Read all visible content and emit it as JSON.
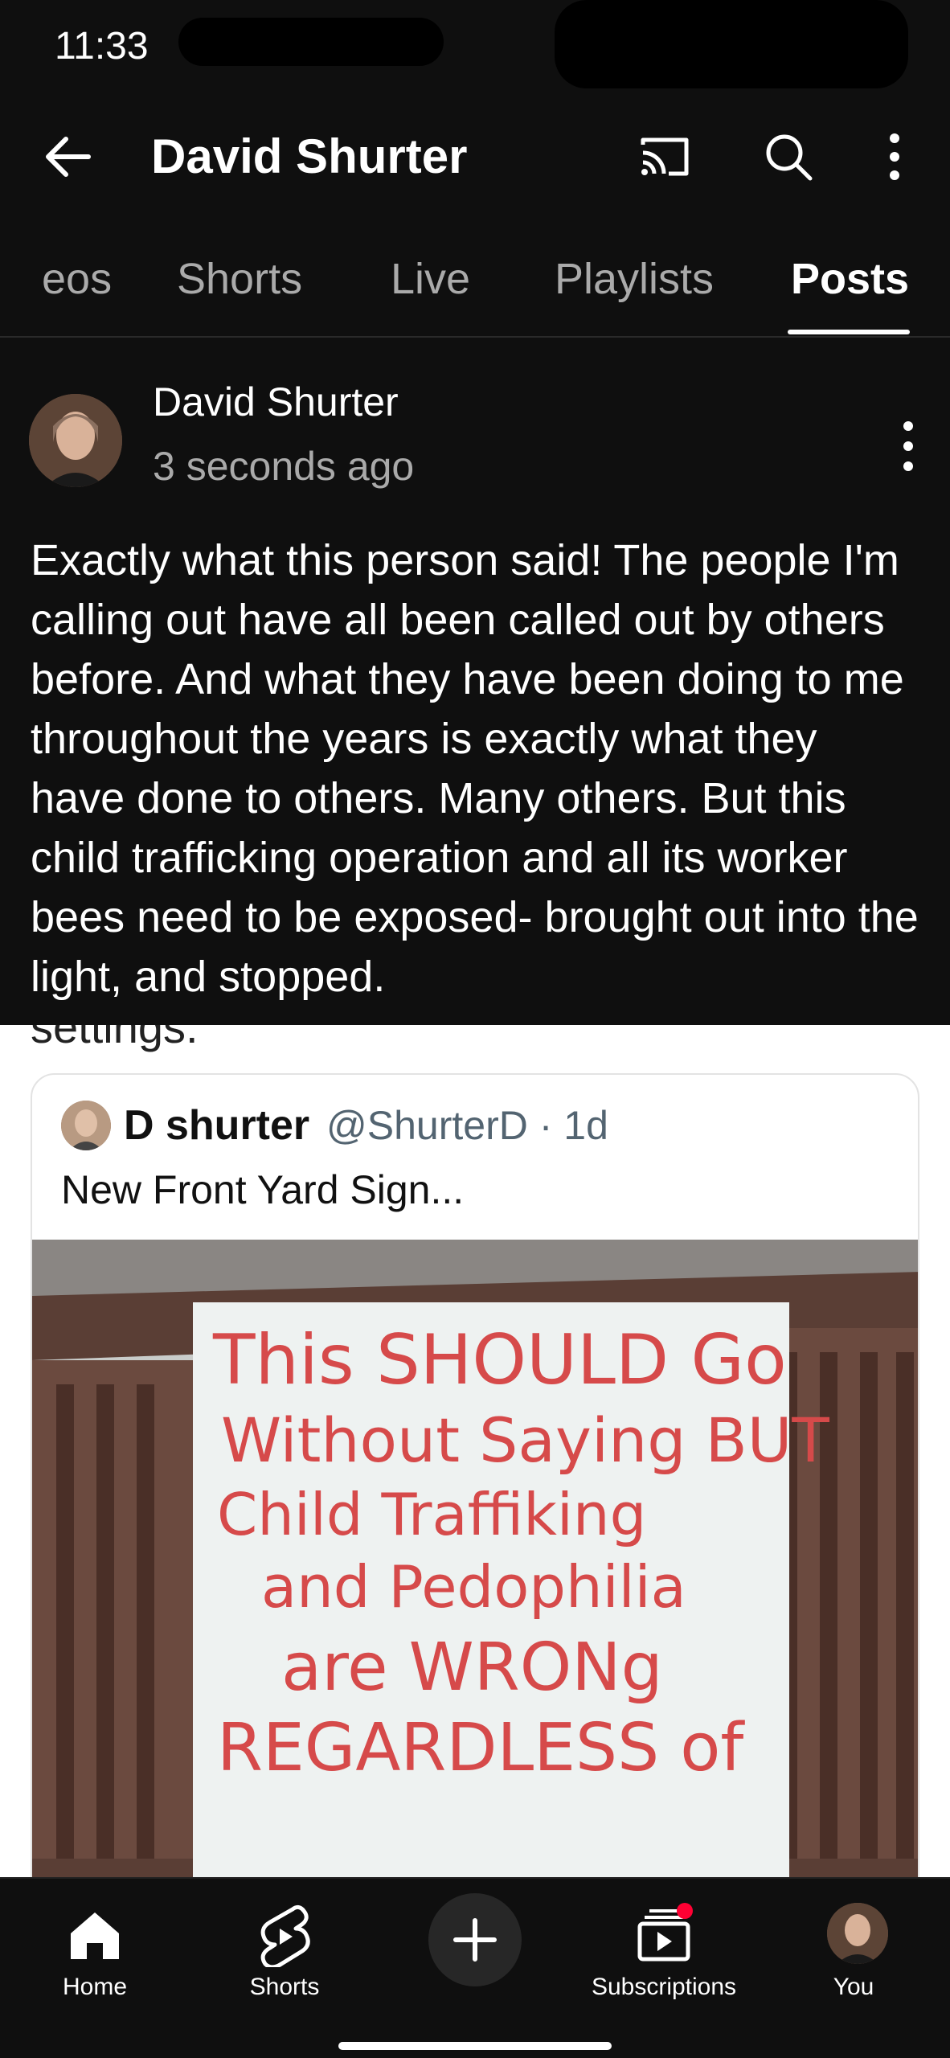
{
  "status": {
    "time": "11:33"
  },
  "app_bar": {
    "title": "David Shurter"
  },
  "tabs": [
    {
      "label": "eos"
    },
    {
      "label": "Shorts"
    },
    {
      "label": "Live"
    },
    {
      "label": "Playlists"
    },
    {
      "label": "Posts",
      "active": true
    }
  ],
  "post": {
    "author": "David Shurter",
    "time": "3 seconds ago",
    "text": "Exactly what this person said! The people I'm calling out have all been called out by others before. And what they have been doing to me throughout the years is exactly what they have done to others. Many others. But this child trafficking operation and all its worker bees need to be exposed- brought out into the light, and stopped."
  },
  "embed": {
    "cutoff_text": "settings.",
    "tweet_name": "D shurter",
    "tweet_handle": "@ShurterD · 1d",
    "tweet_text": "New Front Yard Sign...",
    "sign_lines": [
      "This SHOULD Go",
      "Without Saying BUT",
      "Child Traffiking",
      "and Pedophilia",
      "are WRONg",
      "REGARDLESS of"
    ]
  },
  "bottom_nav": {
    "home": "Home",
    "shorts": "Shorts",
    "subscriptions": "Subscriptions",
    "you": "You"
  },
  "colors": {
    "background": "#0f0f0f",
    "sign_red": "#d64a4a",
    "notification_dot": "#ff0033"
  }
}
